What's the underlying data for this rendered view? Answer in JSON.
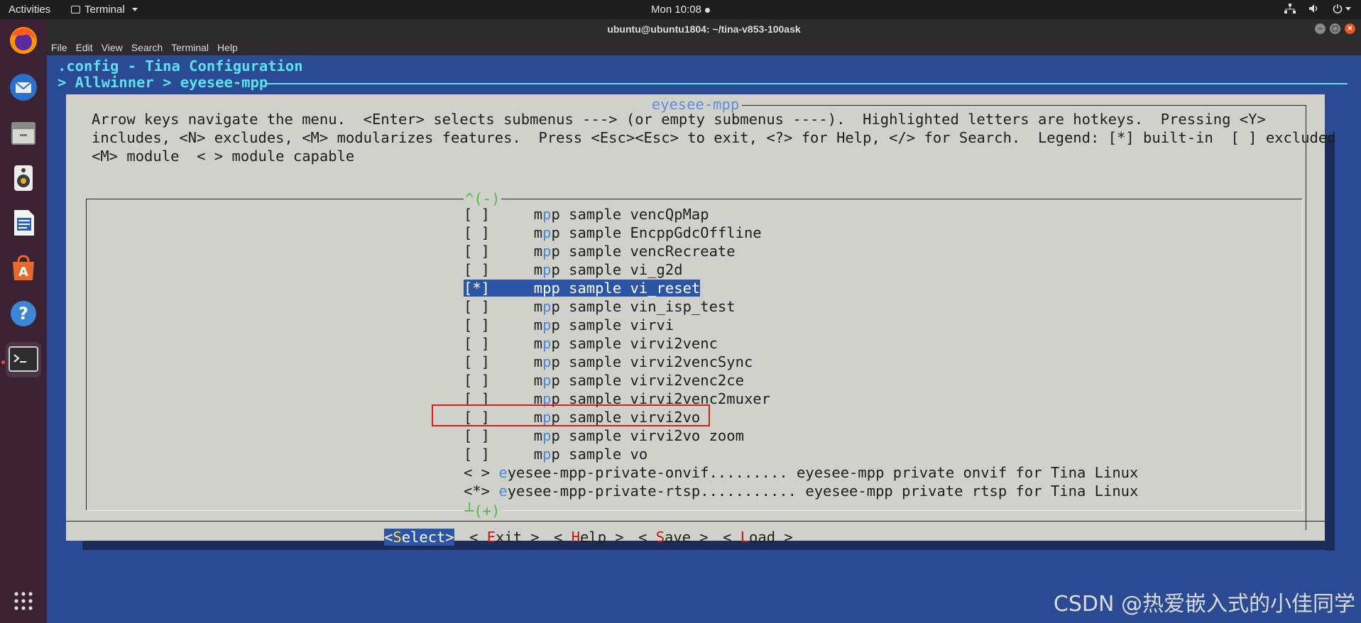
{
  "topbar": {
    "activities": "Activities",
    "app_name": "Terminal",
    "clock": "Mon 10:08"
  },
  "window": {
    "title": "ubuntu@ubuntu1804: ~/tina-v853-100ask",
    "menu": [
      "File",
      "Edit",
      "View",
      "Search",
      "Terminal",
      "Help"
    ]
  },
  "dock": [
    {
      "name": "firefox-icon"
    },
    {
      "name": "thunderbird-icon"
    },
    {
      "name": "files-icon"
    },
    {
      "name": "rhythmbox-icon"
    },
    {
      "name": "writer-icon"
    },
    {
      "name": "software-icon"
    },
    {
      "name": "help-icon"
    },
    {
      "name": "terminal-icon"
    },
    {
      "name": "show-apps-icon"
    }
  ],
  "terminal": {
    "config_title": ".config - Tina Configuration",
    "breadcrumb": "> Allwinner > eyesee-mpp",
    "dialog_title": "eyesee-mpp",
    "help_lines": [
      "Arrow keys navigate the menu.  <Enter> selects submenus ---> (or empty submenus ----).  Highlighted letters are hotkeys.  Pressing <Y>",
      "includes, <N> excludes, <M> modularizes features.  Press <Esc><Esc> to exit, <?> for Help, </> for Search.  Legend: [*] built-in  [ ] excluded",
      "<M> module  < > module capable"
    ],
    "scroll_up": "^(-)",
    "scroll_down": "┴(+)",
    "items": [
      {
        "box": "[ ]",
        "pre": "     m",
        "hk": "p",
        "rest": "p sample vencQpMap"
      },
      {
        "box": "[ ]",
        "pre": "     m",
        "hk": "p",
        "rest": "p sample EncppGdcOffline"
      },
      {
        "box": "[ ]",
        "pre": "     m",
        "hk": "p",
        "rest": "p sample vencRecreate"
      },
      {
        "box": "[ ]",
        "pre": "     m",
        "hk": "p",
        "rest": "p sample vi_g2d"
      },
      {
        "box": "[*]",
        "pre": "     m",
        "hk": "p",
        "rest": "p sample vi_reset",
        "selected": true
      },
      {
        "box": "[ ]",
        "pre": "     m",
        "hk": "p",
        "rest": "p sample vin_isp_test"
      },
      {
        "box": "[ ]",
        "pre": "     m",
        "hk": "p",
        "rest": "p sample virvi"
      },
      {
        "box": "[ ]",
        "pre": "     m",
        "hk": "p",
        "rest": "p sample virvi2venc"
      },
      {
        "box": "[ ]",
        "pre": "     m",
        "hk": "p",
        "rest": "p sample virvi2vencSync"
      },
      {
        "box": "[ ]",
        "pre": "     m",
        "hk": "p",
        "rest": "p sample virvi2venc2ce"
      },
      {
        "box": "[ ]",
        "pre": "     m",
        "hk": "p",
        "rest": "p sample virvi2venc2muxer"
      },
      {
        "box": "[ ]",
        "pre": "     m",
        "hk": "p",
        "rest": "p sample virvi2vo"
      },
      {
        "box": "[ ]",
        "pre": "     m",
        "hk": "p",
        "rest": "p sample virvi2vo zoom"
      },
      {
        "box": "[ ]",
        "pre": "     m",
        "hk": "p",
        "rest": "p sample vo"
      },
      {
        "box": "< >",
        "pre": " ",
        "hk": "e",
        "rest": "yesee-mpp-private-onvif......... eyesee-mpp private onvif for Tina Linux"
      },
      {
        "box": "<*>",
        "pre": " ",
        "hk": "e",
        "rest": "yesee-mpp-private-rtsp........... eyesee-mpp private rtsp for Tina Linux"
      }
    ],
    "buttons": [
      {
        "open": "<",
        "hk": "S",
        "rest": "elect>",
        "active": true
      },
      {
        "open": "< ",
        "hk": "E",
        "rest": "xit >"
      },
      {
        "open": "< ",
        "hk": "H",
        "rest": "elp >"
      },
      {
        "open": "< ",
        "hk": "S",
        "rest": "ave >"
      },
      {
        "open": "< ",
        "hk": "L",
        "rest": "oad >"
      }
    ]
  },
  "watermark": "CSDN @热爱嵌入式的小佳同学",
  "colors": {
    "terminal_bg": "#2a4a93",
    "dialog_bg": "#cfd1ca",
    "title_cyan": "#5ee0f0",
    "selection": "#2c55a7",
    "hotkey_blue": "#4b8ad6",
    "hotkey_red": "#c01818",
    "highlight_box": "#d02020"
  }
}
